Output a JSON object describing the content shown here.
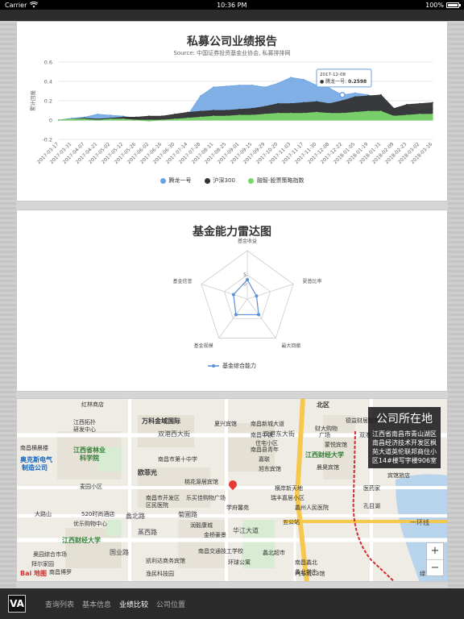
{
  "status": {
    "carrier": "Carrier",
    "time": "10:36 PM",
    "battery": "100%",
    "battery_level": 1.0
  },
  "performance": {
    "title": "私募公司业绩报告",
    "subtitle": "Source: 中国证券投资基金业协会, 私募排排网",
    "tooltip": {
      "date": "2017-12-08",
      "series": "腾龙一号",
      "value": "0.2598"
    }
  },
  "radar": {
    "title": "基金能力雷达图"
  },
  "map": {
    "overlay_title": "公司所在地",
    "overlay_address": "江西省南昌市青山湖区南昌经济技术开发区枫苑大道英伦联邦商住小区14#楼写字楼906室",
    "zoom_in": "+",
    "zoom_out": "−",
    "brand": "Bai 地图",
    "labels": {
      "l1": "红林商店",
      "l2": "江西拓扑",
      "l3": "研发中心",
      "l4": "万科金域国际",
      "l5": "夏兴宾馆",
      "l6": "双港西大街",
      "l7": "双港东大街",
      "l8": "南昌市第十中学",
      "l9": "江西省林业",
      "l10": "科学院",
      "l11": "南昌横晨楼",
      "l12": "奥克斯电气",
      "l13": "制造公司",
      "l14": "欧菲光",
      "l15": "麦园小区",
      "l16": "桃花源居宾馆",
      "l17": "南昌市开发区",
      "l18": "区民医院",
      "l19": "乐买佳购物广场",
      "l20": "学府馨苑",
      "l21": "横岸新天地",
      "l22": "大路山",
      "l23": "520时尚酒店",
      "l24": "优乐购物中心",
      "l25": "蠡北路",
      "l26": "菊圃路",
      "l27": "江西财经大学",
      "l28": "润毅康城",
      "l29": "金桥豪景",
      "l30": "华江大道",
      "l31": "蒸西路",
      "l32": "奥园综合市场",
      "l33": "拜尔家园",
      "l34": "南昌博罗",
      "l35": "国业路",
      "l36": "凯利达商务宾馆",
      "l37": "南昌交通技工学校",
      "l38": "环球公寓",
      "l39": "蠡北超市",
      "l40": "渔民科技园",
      "l41": "江西财经大学",
      "l42": "南昌县青年",
      "l43": "嘉联",
      "l44": "旭东宾馆",
      "l45": "南昌中铁",
      "l46": "住宅小区",
      "l47": "南昌新城大道",
      "l48": "双港",
      "l49": "财大购物",
      "l50": "广场",
      "l51": "北区",
      "l52": "德益财居超市",
      "l53": "蒙悦宾馆",
      "l54": "晨昊宾馆",
      "l55": "孔目湖",
      "l56": "医药家",
      "l57": "一环线",
      "l58": "蠡州人民医院",
      "l59": "瑞丰嘉居小区",
      "l60": "五公站",
      "l61": "蠡北学生",
      "l62": "南昌蠡北",
      "l63": "汽车城C3馆",
      "l64": "绿意园",
      "l65": "宾馆旅店"
    }
  },
  "nav": {
    "logo": "VA",
    "items": [
      "查询列表",
      "基本信息",
      "业绩比较",
      "公司位置"
    ],
    "active_index": 2
  },
  "chart_data": [
    {
      "type": "area",
      "title": "私募公司业绩报告",
      "subtitle": "Source: 中国证券投资基金业协会, 私募排排网",
      "ylabel": "累计回报",
      "ylim": [
        -0.2,
        0.6
      ],
      "yticks": [
        "-0.2",
        "0",
        "0.2",
        "0.4",
        "0.6"
      ],
      "grid": true,
      "legend_position": "bottom",
      "x_ticks": [
        "2017-03-17",
        "2017-03-31",
        "2017-04-07",
        "2017-04-21",
        "2017-05-02",
        "2017-05-12",
        "2017-05-26",
        "2017-06-02",
        "2017-06-16",
        "2017-06-30",
        "2017-07-14",
        "2017-07-28",
        "2017-08-11",
        "2017-08-25",
        "2017-09-01",
        "2017-09-15",
        "2017-09-29",
        "2017-10-20",
        "2017-11-03",
        "2017-11-17",
        "2017-11-30",
        "2017-12-08",
        "2017-12-22",
        "2018-01-05",
        "2018-01-19",
        "2018-01-31",
        "2018-02-09",
        "2018-02-23",
        "2018-03-02",
        "2018-03-16"
      ],
      "x_tick_labels_shown": [
        "2017-03-17",
        "2017-03-31",
        "2017-04-07",
        "2017-04-21",
        "2017-05-02",
        "2017-05-12",
        "2017-05-26",
        "2017-06-02",
        "2017-06-16",
        "2017-06-30",
        "2017-07-14",
        "2017-07-28",
        "2017-08-11",
        "2017-08-25",
        "2017-09-01",
        "2017-09-15",
        "2017-09-29",
        "2017-10-20",
        "2017-11-03",
        "2017-11-17",
        "2017-11-30",
        "2017-12-08",
        "2017-12-22",
        "2018-01-05",
        "2018-01-19",
        "2018-01-31",
        "2018-02-09",
        "2018-02-23",
        "2018-03-02",
        "2018-03-16"
      ],
      "series": [
        {
          "name": "腾龙一号",
          "color": "#6aa2e0",
          "values": [
            0.0,
            0.02,
            0.03,
            0.06,
            0.05,
            0.04,
            0.02,
            0.0,
            0.0,
            0.02,
            0.05,
            0.25,
            0.34,
            0.35,
            0.36,
            0.36,
            0.34,
            0.38,
            0.44,
            0.42,
            0.36,
            0.33,
            0.2598,
            0.28,
            0.26,
            0.22,
            0.12,
            0.14,
            0.1,
            0.12
          ]
        },
        {
          "name": "沪深300",
          "color": "#333333",
          "values": [
            0.0,
            0.01,
            0.02,
            0.01,
            0.02,
            0.03,
            0.03,
            0.04,
            0.04,
            0.06,
            0.08,
            0.09,
            0.1,
            0.1,
            0.11,
            0.12,
            0.14,
            0.17,
            0.17,
            0.18,
            0.19,
            0.17,
            0.2,
            0.24,
            0.25,
            0.26,
            0.12,
            0.16,
            0.17,
            0.18
          ]
        },
        {
          "name": "融智-股票策略指数",
          "color": "#7bd66b",
          "values": [
            0.0,
            0.01,
            0.01,
            0.0,
            0.01,
            0.01,
            0.0,
            -0.01,
            0.0,
            0.01,
            0.02,
            0.03,
            0.04,
            0.04,
            0.05,
            0.05,
            0.06,
            0.07,
            0.07,
            0.07,
            0.08,
            0.07,
            0.07,
            0.08,
            0.09,
            0.09,
            0.04,
            0.05,
            0.06,
            0.06
          ]
        }
      ]
    },
    {
      "type": "radar",
      "title": "基金能力雷达图",
      "axes": [
        "基金收益",
        "夏普比率",
        "最大回撤",
        "基金规模",
        "基金信誉"
      ],
      "rtick_labels": [
        "0",
        "5"
      ],
      "rlim": [
        0,
        10
      ],
      "legend_position": "bottom",
      "series": [
        {
          "name": "基金综合能力",
          "color": "#5b8fd6",
          "values": [
            4,
            2,
            4,
            4,
            3
          ]
        }
      ]
    }
  ]
}
